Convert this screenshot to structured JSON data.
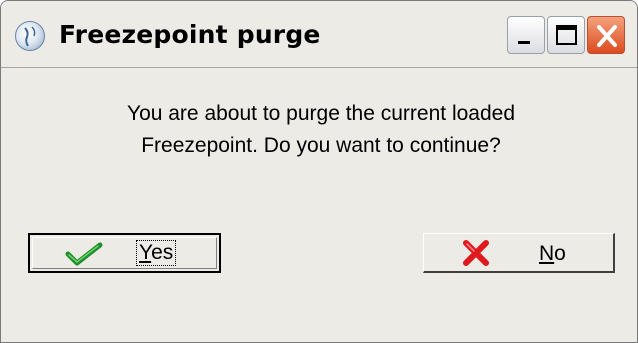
{
  "window": {
    "title": "Freezepoint purge",
    "icon": "globe-icon",
    "controls": [
      "minimize",
      "maximize",
      "close"
    ]
  },
  "dialog": {
    "message_line1": "You are about to purge the current loaded",
    "message_line2": "Freezepoint. Do you want to continue?"
  },
  "buttons": {
    "yes": {
      "mnemonic": "Y",
      "rest": "es",
      "icon": "checkmark-icon",
      "icon_color": "#1e8f2a"
    },
    "no": {
      "mnemonic": "N",
      "rest": "o",
      "icon": "red-x-icon",
      "icon_color": "#e0191f"
    }
  },
  "colors": {
    "dialog_bg": "#ecebe6",
    "close_button": "#dd4a1f"
  }
}
